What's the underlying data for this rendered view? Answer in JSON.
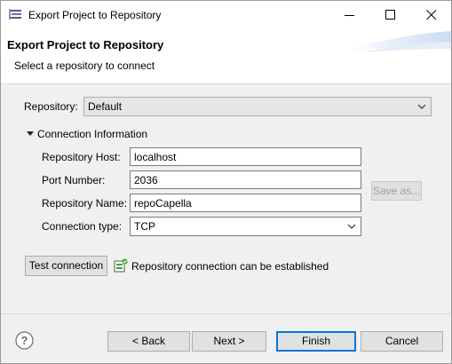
{
  "window": {
    "title": "Export Project to Repository",
    "minimize_icon": "minimize-icon",
    "maximize_icon": "maximize-icon",
    "close_icon": "close-icon",
    "app_icon": "capella-app-icon"
  },
  "header": {
    "title": "Export Project to Repository",
    "description": "Select a repository to connect"
  },
  "repository": {
    "label": "Repository:",
    "selected": "Default"
  },
  "connection": {
    "section_label": "Connection Information",
    "expanded": true,
    "host_label": "Repository Host:",
    "host_value": "localhost",
    "port_label": "Port Number:",
    "port_value": "2036",
    "name_label": "Repository Name:",
    "name_value": "repoCapella",
    "type_label": "Connection type:",
    "type_selected": "TCP",
    "save_as_label": "Save as..."
  },
  "test": {
    "button_label": "Test connection",
    "status_icon": "repository-connected-icon",
    "status_text": "Repository connection can be established"
  },
  "footer": {
    "help_icon": "help-icon",
    "back_label": "< Back",
    "next_label": "Next >",
    "finish_label": "Finish",
    "cancel_label": "Cancel"
  },
  "colors": {
    "dialog_bg": "#f0f0f0",
    "accent": "#0078d7",
    "banner_art": "#d6e4f5"
  }
}
